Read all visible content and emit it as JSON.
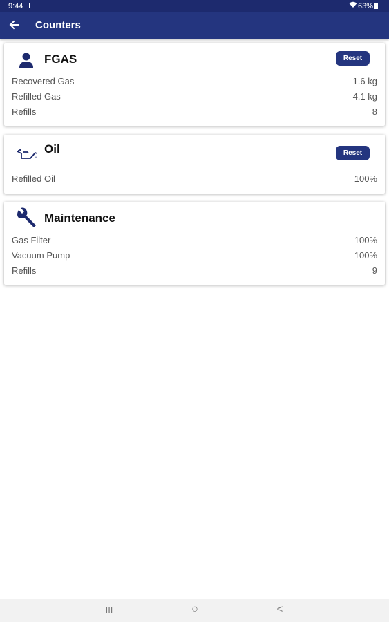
{
  "status_bar": {
    "time": "9:44",
    "battery": "63%"
  },
  "app_bar": {
    "title": "Counters"
  },
  "cards": {
    "fgas": {
      "title": "FGAS",
      "reset_label": "Reset",
      "rows": [
        {
          "label": "Recovered Gas",
          "value": "1.6 kg"
        },
        {
          "label": "Refilled Gas",
          "value": "4.1 kg"
        },
        {
          "label": "Refills",
          "value": "8"
        }
      ]
    },
    "oil": {
      "title": "Oil",
      "reset_label": "Reset",
      "rows": [
        {
          "label": "Refilled Oil",
          "value": "100%"
        }
      ]
    },
    "maintenance": {
      "title": "Maintenance",
      "rows": [
        {
          "label": "Gas Filter",
          "value": "100%"
        },
        {
          "label": "Vacuum Pump",
          "value": "100%"
        },
        {
          "label": "Refills",
          "value": "9"
        }
      ]
    }
  },
  "nav_bar": {
    "recents": "III",
    "home": "○",
    "back": "<"
  },
  "colors": {
    "primary": "#24357f",
    "status_bar": "#1d2a6e",
    "icon": "#1d2a6e"
  }
}
